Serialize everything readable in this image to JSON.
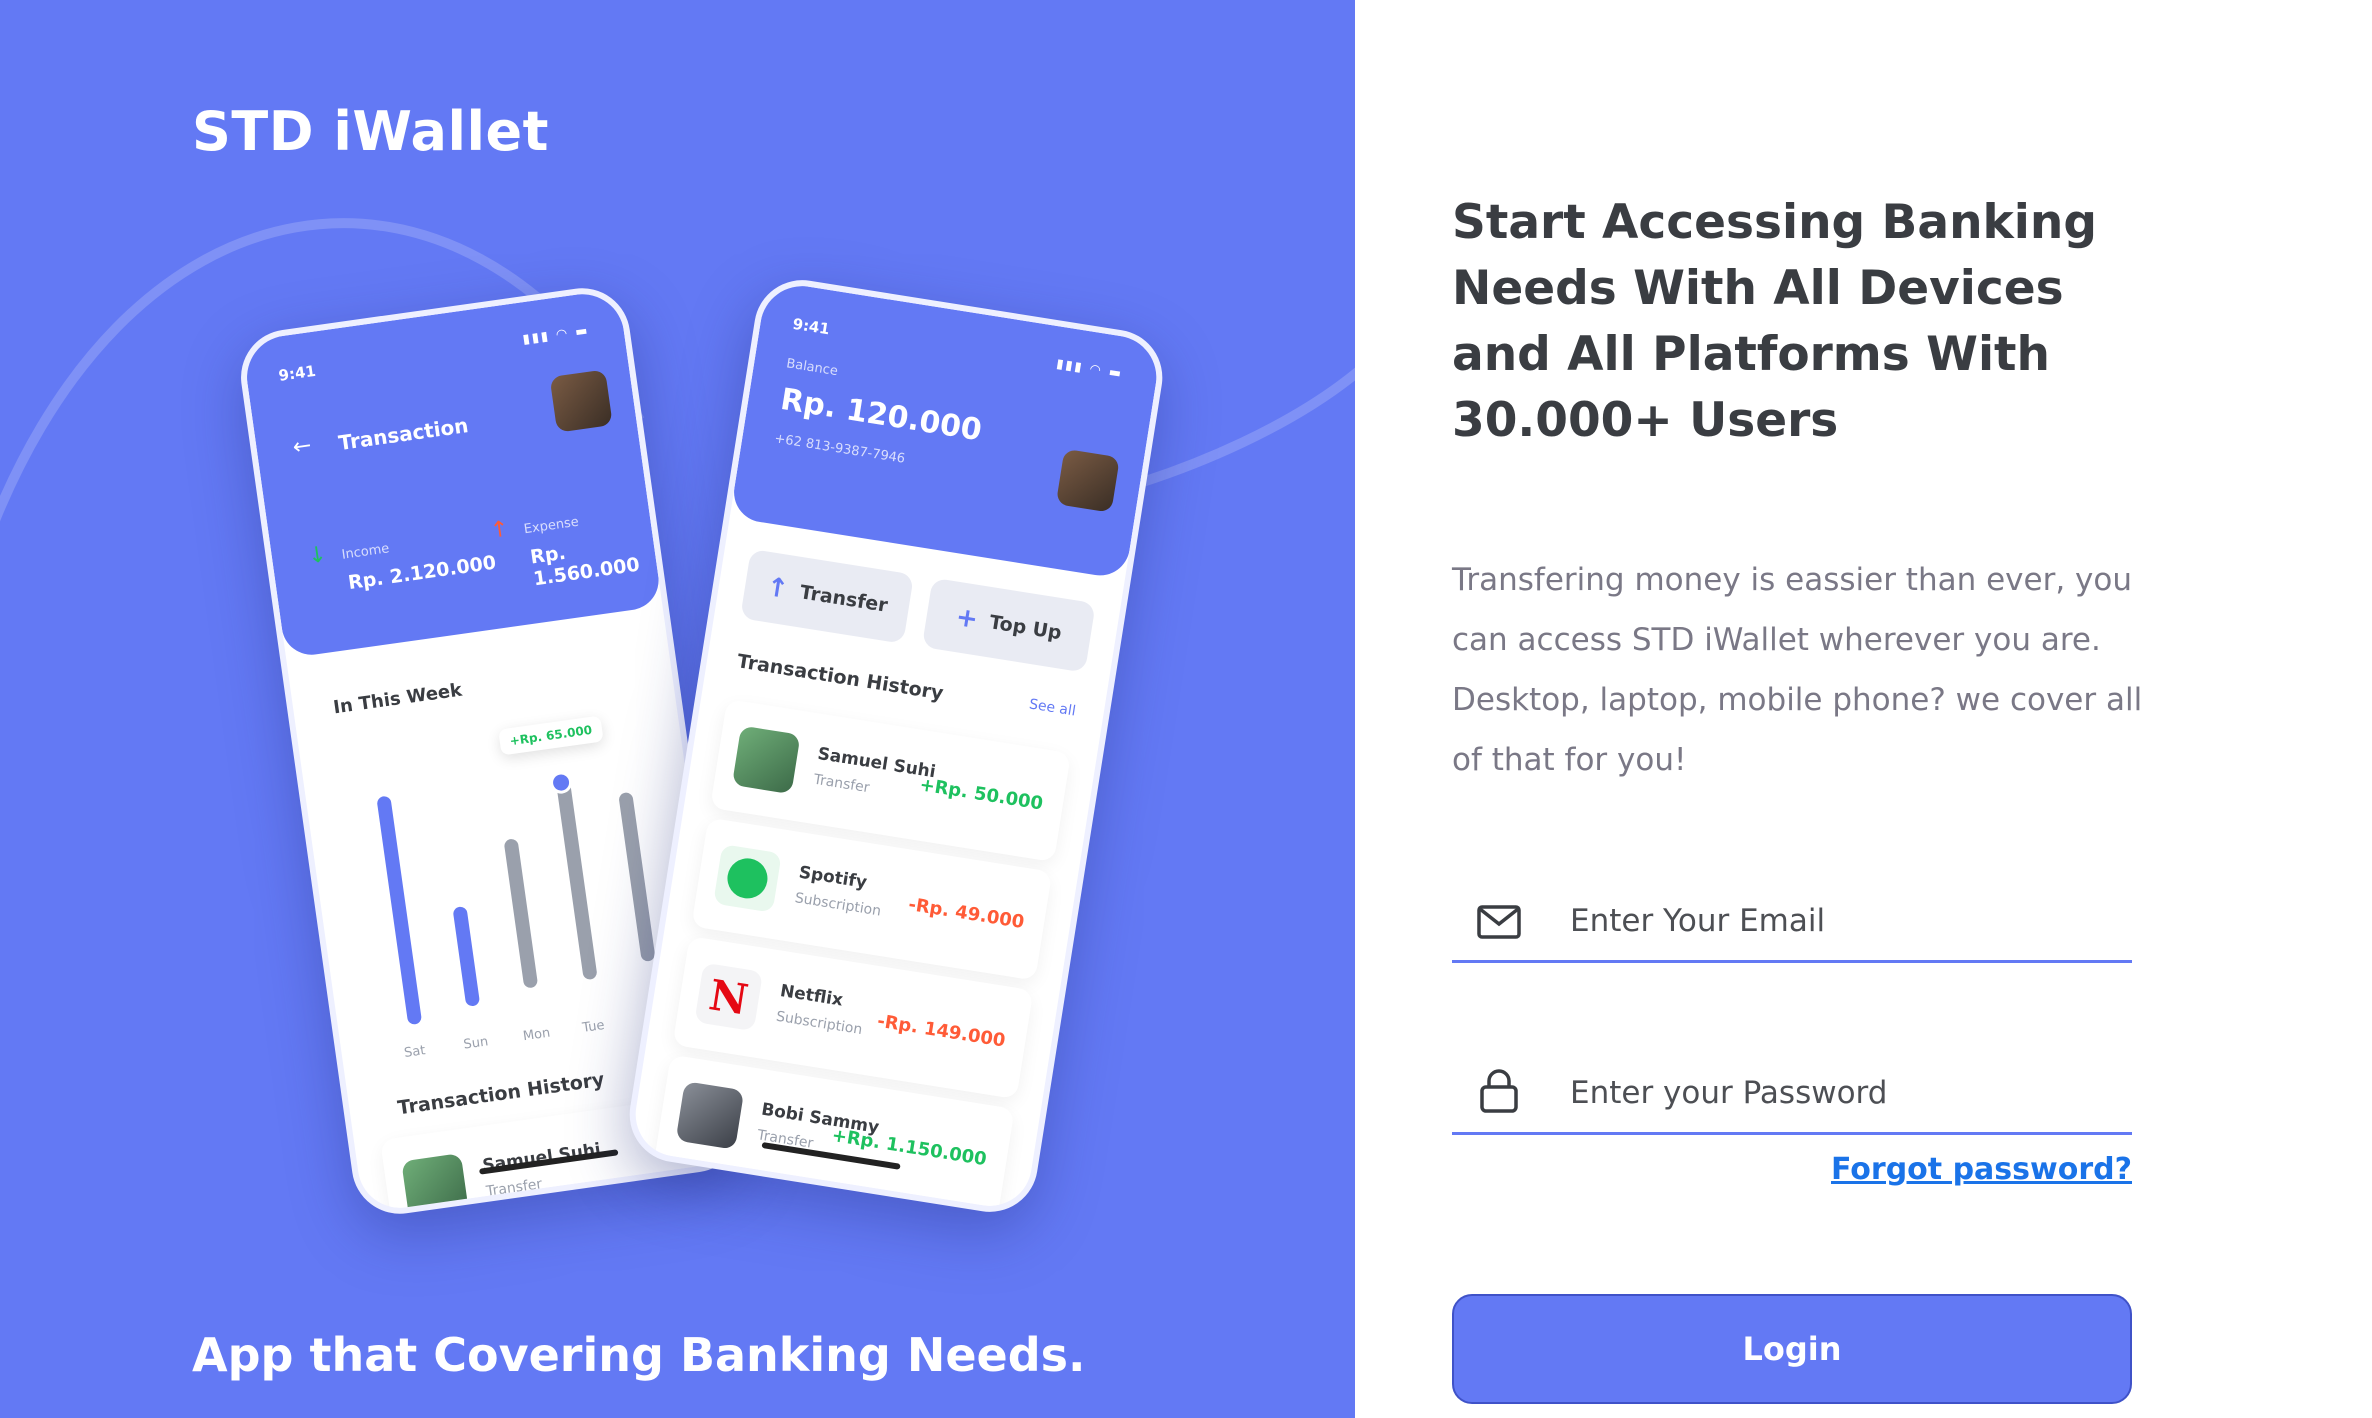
{
  "brand": "STD iWallet",
  "tagline": "App that Covering Banking Needs.",
  "heading": "Start Accessing Banking Needs With All Devices and All Platforms With 30.000+ Users",
  "description": "Transfering money is eassier than ever, you can access STD iWallet wherever you are. Desktop, laptop, mobile phone? we cover all of that for you!",
  "form": {
    "email_placeholder": "Enter Your Email",
    "password_placeholder": "Enter your Password",
    "forgot_label": "Forgot password?",
    "login_label": "Login"
  },
  "colors": {
    "primary": "#6379F4",
    "income": "#1EC15F",
    "expense": "#FF5B37"
  },
  "phone1": {
    "time": "9:41",
    "title": "Transaction",
    "income_label": "Income",
    "income_amount": "Rp. 2.120.000",
    "expense_label": "Expense",
    "expense_amount": "Rp. 1.560.000",
    "week_label": "In This Week",
    "bubble": "+Rp. 65.000",
    "days": [
      "Sat",
      "Sun",
      "Mon",
      "Tue"
    ],
    "history_label": "Transaction History",
    "row_name": "Samuel Suhi",
    "row_sub": "Transfer"
  },
  "phone2": {
    "time": "9:41",
    "balance_label": "Balance",
    "balance": "Rp. 120.000",
    "phone": "+62 813-9387-7946",
    "transfer_label": "Transfer",
    "topup_label": "Top Up",
    "history_label": "Transaction History",
    "see_all": "See all",
    "transactions": [
      {
        "name": "Samuel Suhi",
        "type": "Transfer",
        "amount": "+Rp. 50.000"
      },
      {
        "name": "Spotify",
        "type": "Subscription",
        "amount": "-Rp. 49.000"
      },
      {
        "name": "Netflix",
        "type": "Subscription",
        "amount": "-Rp. 149.000"
      },
      {
        "name": "Bobi Sammy",
        "type": "Transfer",
        "amount": "+Rp. 1.150.000"
      }
    ]
  }
}
